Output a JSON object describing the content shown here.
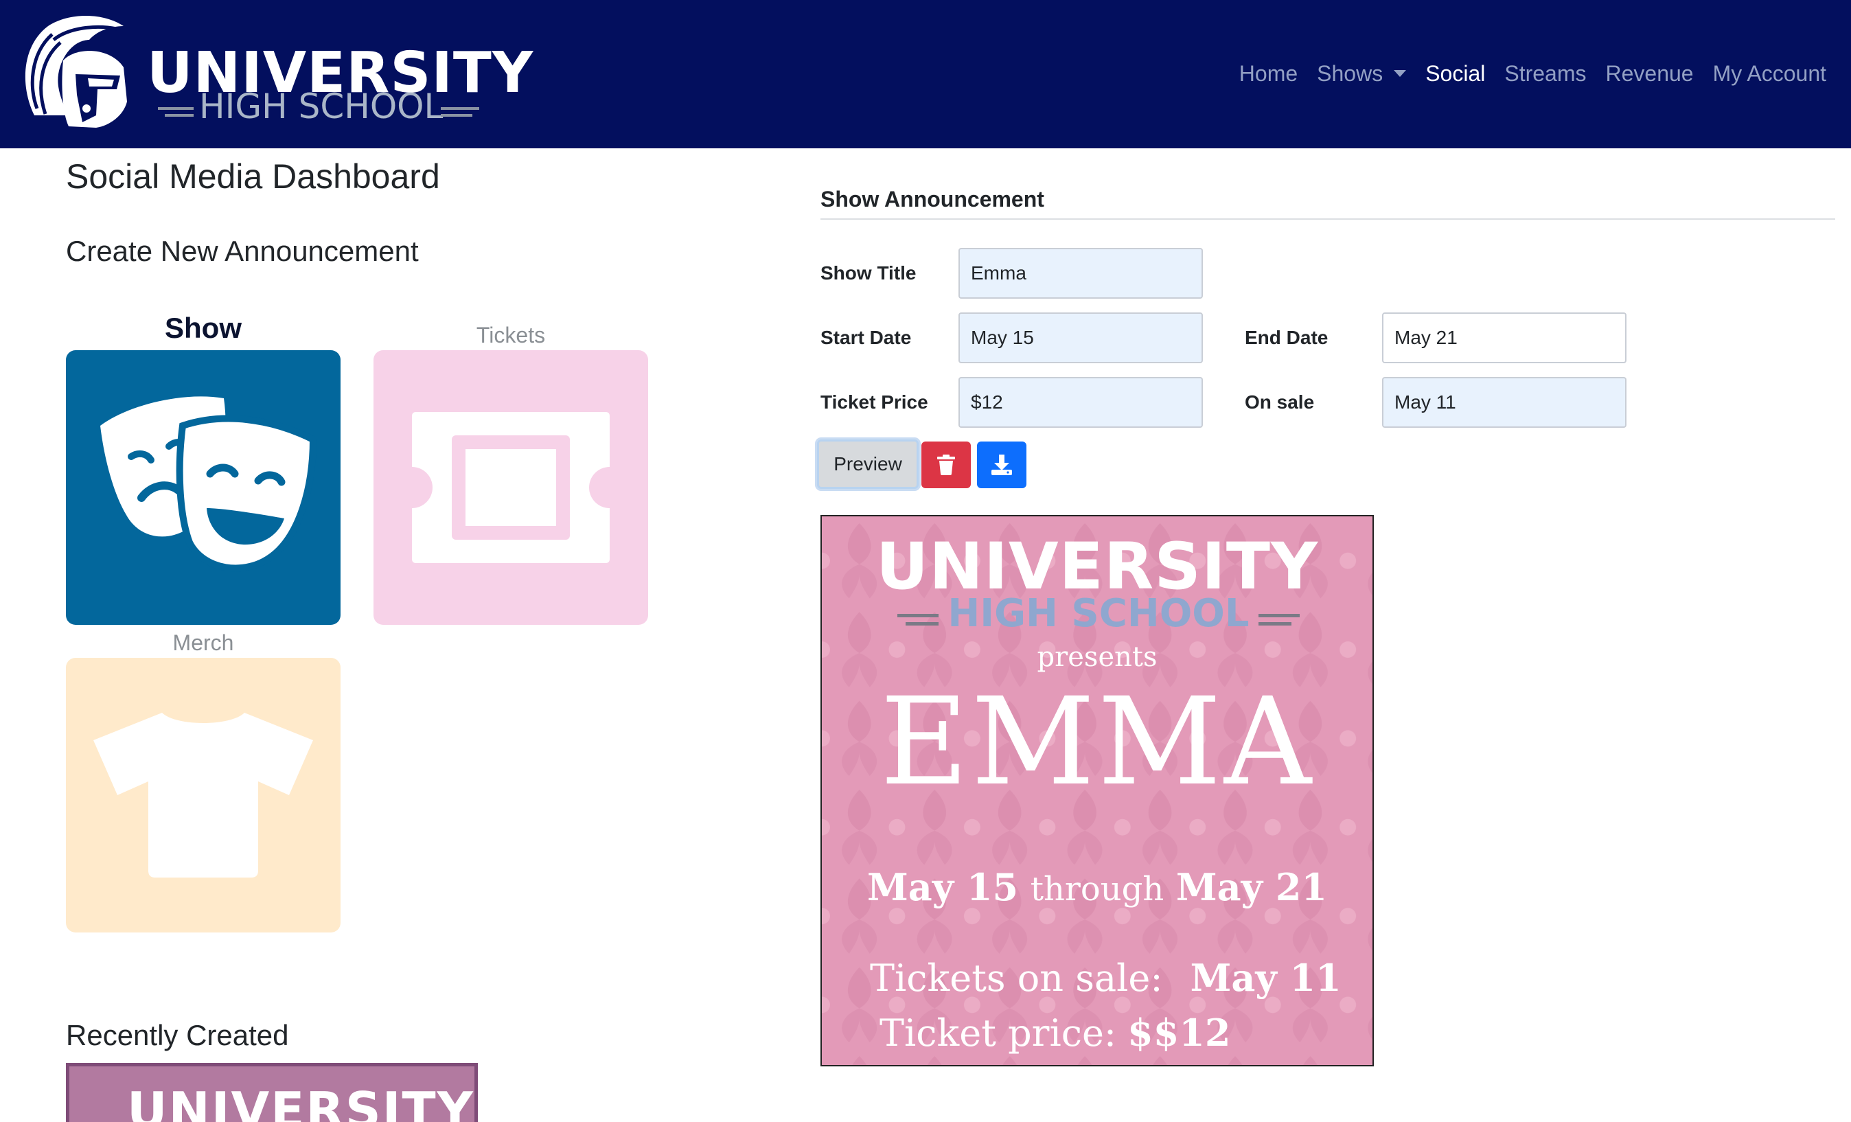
{
  "brand": {
    "line1": "UNIVERSITY",
    "line2": "HIGH SCHOOL",
    "logo_icon": "trojan-helmet-icon"
  },
  "nav": {
    "items": [
      {
        "label": "Home",
        "active": false
      },
      {
        "label": "Shows",
        "active": false,
        "dropdown": true
      },
      {
        "label": "Social",
        "active": true
      },
      {
        "label": "Streams",
        "active": false
      },
      {
        "label": "Revenue",
        "active": false
      },
      {
        "label": "My Account",
        "active": false
      }
    ]
  },
  "page": {
    "title": "Social Media Dashboard",
    "create_title": "Create New Announcement",
    "recent_title": "Recently Created"
  },
  "types": [
    {
      "label": "Show",
      "selected": true,
      "icon": "theater-masks-icon",
      "color": "#03679c"
    },
    {
      "label": "Tickets",
      "selected": false,
      "icon": "ticket-icon",
      "color": "#f7d2e8"
    },
    {
      "label": "Merch",
      "selected": false,
      "icon": "tshirt-icon",
      "color": "#ffeacb"
    }
  ],
  "recent": {
    "thumb_text": "UNIVERSITY"
  },
  "form": {
    "title": "Show Announcement",
    "show_title": {
      "label": "Show Title",
      "value": "Emma"
    },
    "start_date": {
      "label": "Start Date",
      "value": "May 15"
    },
    "end_date": {
      "label": "End Date",
      "value": "May 21"
    },
    "ticket_price": {
      "label": "Ticket Price",
      "value": "$12"
    },
    "on_sale": {
      "label": "On sale",
      "value": "May 11"
    },
    "preview_label": "Preview",
    "delete_icon": "trash-icon",
    "download_icon": "download-icon"
  },
  "poster": {
    "line1": "UNIVERSITY",
    "line2": "HIGH SCHOOL",
    "presents": "presents",
    "title": "EMMA",
    "start": "May 15",
    "through": "through",
    "end": "May 21",
    "sale_label": "Tickets on sale:",
    "sale_value": "May 11",
    "price_label": "Ticket price:",
    "price_value": "$$12",
    "background_color": "#e39ab8"
  }
}
